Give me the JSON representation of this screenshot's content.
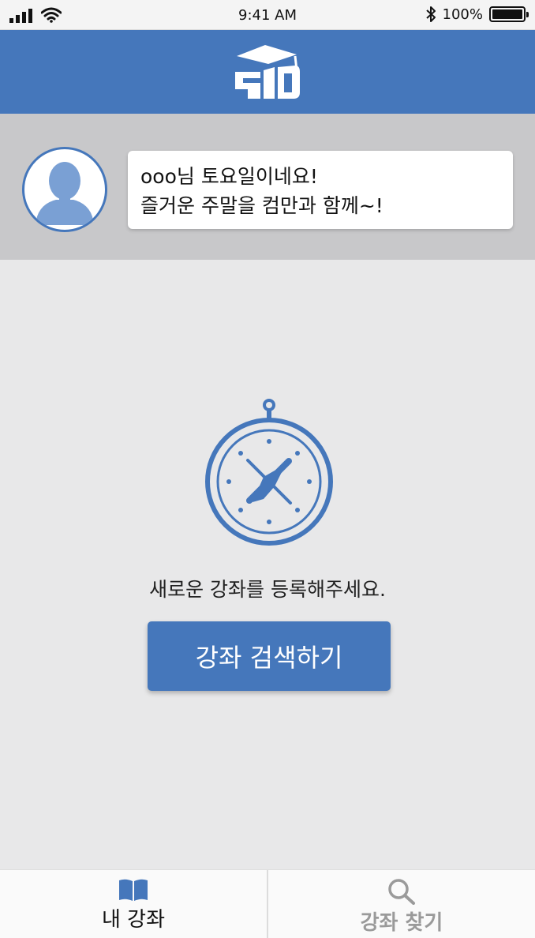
{
  "status_bar": {
    "time": "9:41 AM",
    "battery_percent": "100%",
    "battery_level": 1.0,
    "icons": [
      "signal-icon",
      "wifi-icon",
      "bluetooth-icon",
      "battery-icon"
    ]
  },
  "header": {
    "logo_icon": "graduation-cap-logo-icon"
  },
  "greeting": {
    "avatar_icon": "user-silhouette-icon",
    "line1": "ooo님 토요일이네요!",
    "line2": "즐거운 주말을 컴만과 함께~!"
  },
  "empty_state": {
    "icon": "compass-icon",
    "message": "새로운 강좌를 등록해주세요.",
    "button_label": "강좌 검색하기"
  },
  "bottom_nav": {
    "items": [
      {
        "label": "내 강좌",
        "icon": "book-icon",
        "active": true
      },
      {
        "label": "강좌 찾기",
        "icon": "search-icon",
        "active": false
      }
    ]
  },
  "colors": {
    "brand": "#4577bb",
    "background": "#e8e8e9",
    "greeting_panel": "#c8c8ca",
    "inactive_text": "#9a9a9a"
  }
}
